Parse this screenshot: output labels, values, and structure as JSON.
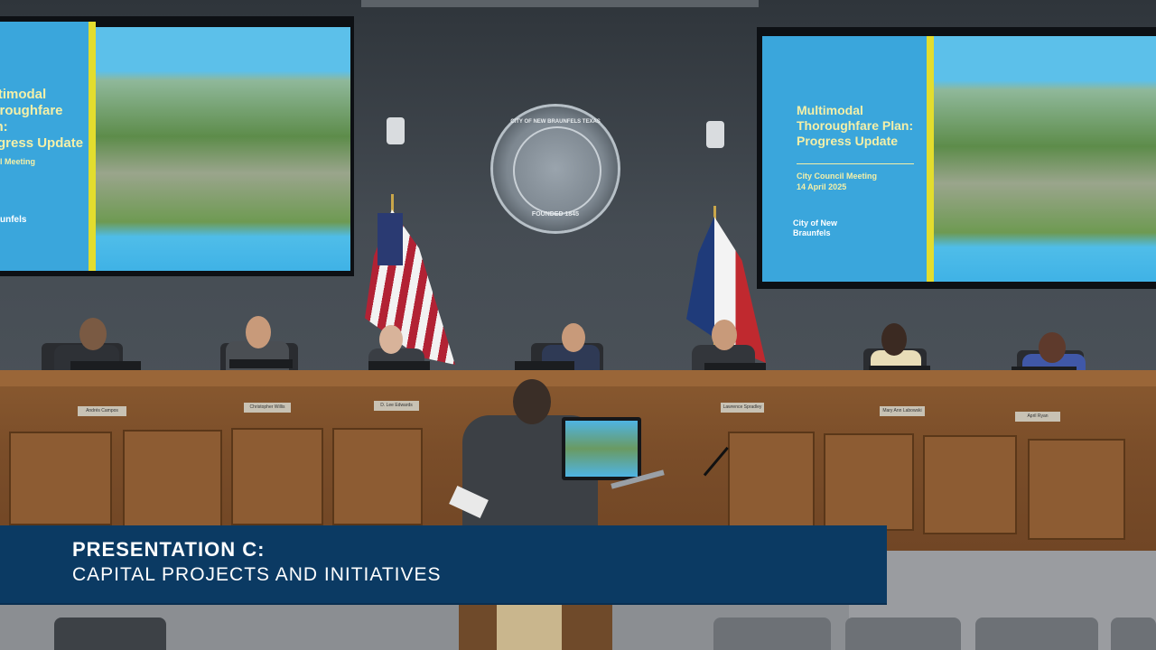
{
  "left_slide": {
    "title_lines": [
      "Multimodal",
      "Thoroughfare Plan:",
      "Progress Update"
    ],
    "meeting": "City Council Meeting",
    "logo": "New Braunfels"
  },
  "right_slide": {
    "title_lines": [
      "Multimodal",
      "Thoroughfare Plan:",
      "Progress Update"
    ],
    "meeting": "City Council Meeting",
    "date": "14 April 2025",
    "logo": "City of New Braunfels"
  },
  "seal": {
    "text": "CITY OF NEW BRAUNFELS TEXAS",
    "founded": "FOUNDED 1845"
  },
  "nameplates": [
    "Andrés Campos",
    "Christopher Willis",
    "D. Lee Edwards",
    "Lawrence Spradley",
    "Mary Ann Labowski",
    "April Ryan"
  ],
  "lower_third": {
    "title": "PRESENTATION C:",
    "subtitle": "CAPITAL PROJECTS AND INITIATIVES"
  },
  "colors": {
    "banner": "#0b3a63",
    "slide_blue": "#3aa6dc",
    "slide_accent": "#e3dd2e",
    "wood": "#8a5a30"
  }
}
